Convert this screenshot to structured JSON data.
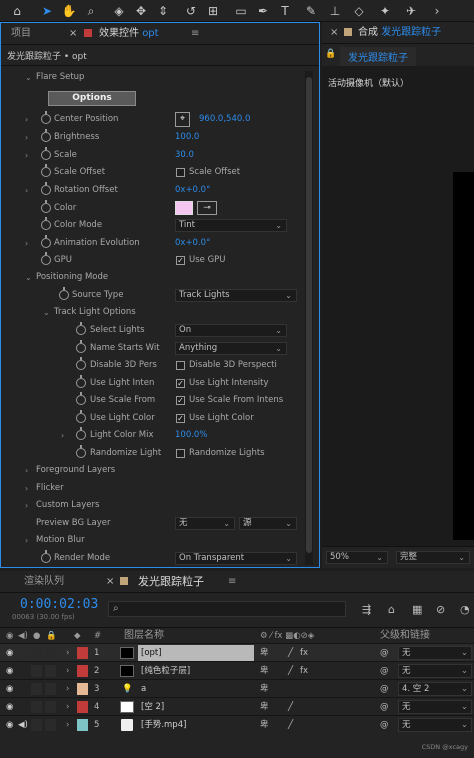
{
  "toolbar": {
    "tools": [
      "home-icon",
      "selection-icon",
      "hand-icon",
      "zoom-icon",
      "orbit-icon",
      "pan-icon",
      "dolly-icon",
      "rotate-icon",
      "shape-icon",
      "rectangle-icon",
      "pen-icon",
      "type-icon",
      "brush-icon",
      "eraser-icon",
      "puppet-icon",
      "pin-icon"
    ]
  },
  "left_tabs": {
    "project": "项目",
    "effects": "效果控件",
    "effects_layer": "opt",
    "menu": "≡"
  },
  "ec": {
    "breadcrumb": "发光跟踪粒子 • opt",
    "flare_setup": "Flare Setup",
    "options_button": "Options",
    "center_position": {
      "label": "Center Position",
      "value": "960.0,540.0"
    },
    "brightness": {
      "label": "Brightness",
      "value": "100.0"
    },
    "scale": {
      "label": "Scale",
      "value": "30.0"
    },
    "scale_offset": {
      "label": "Scale Offset",
      "checkbox": "Scale Offset"
    },
    "rotation_offset": {
      "label": "Rotation Offset",
      "value": "0x+0.0°"
    },
    "color": {
      "label": "Color",
      "swatch": "#f5c6ef"
    },
    "color_mode": {
      "label": "Color Mode",
      "value": "Tint"
    },
    "animation_evolution": {
      "label": "Animation Evolution",
      "value": "0x+0.0°"
    },
    "gpu": {
      "label": "GPU",
      "checkbox": "Use GPU"
    },
    "positioning_mode": "Positioning Mode",
    "source_type": {
      "label": "Source Type",
      "value": "Track Lights"
    },
    "track_light_options": "Track Light Options",
    "select_lights": {
      "label": "Select Lights",
      "value": "On"
    },
    "name_starts": {
      "label": "Name Starts Wit",
      "value": "Anything"
    },
    "disable_3d": {
      "label": "Disable 3D Pers",
      "checkbox": "Disable 3D Perspecti"
    },
    "use_light_int": {
      "label": "Use Light Inten",
      "checkbox": "Use Light Intensity"
    },
    "use_scale_from": {
      "label": "Use Scale From",
      "checkbox": "Use Scale From Intens"
    },
    "use_light_color": {
      "label": "Use Light Color",
      "checkbox": "Use Light Color"
    },
    "light_color_mix": {
      "label": "Light Color Mix",
      "value": "100.0%"
    },
    "randomize_light": {
      "label": "Randomize Light",
      "checkbox": "Randomize Lights"
    },
    "foreground_layers": "Foreground Layers",
    "flicker": "Flicker",
    "custom_layers": "Custom Layers",
    "preview_bg": {
      "label": "Preview BG Layer",
      "value1": "无",
      "value2": "源"
    },
    "motion_blur": "Motion Blur",
    "render_mode": {
      "label": "Render Mode",
      "value": "On Transparent"
    }
  },
  "comp": {
    "tab_label": "合成",
    "tab_name": "发光跟踪粒子",
    "menu": "≡",
    "sub_tab": "发光跟踪粒子",
    "camera": "活动摄像机（默认）",
    "zoom": "50%",
    "resolution": "完整"
  },
  "timeline": {
    "render_queue": "渲染队列",
    "comp_tab": "发光跟踪粒子",
    "menu": "≡",
    "timecode": "0:00:02:03",
    "frame_info": "00063 (30.00 fps)",
    "search_placeholder": "",
    "col_num": "#",
    "col_name": "图层名称",
    "col_parent": "父级和链接",
    "layers": [
      {
        "num": "1",
        "name": "[opt]",
        "label_color": "#c23b3b",
        "thumb": "#000000",
        "parent": "无",
        "selected": true
      },
      {
        "num": "2",
        "name": "[纯色粒子层]",
        "label_color": "#c23b3b",
        "thumb": "#000000",
        "parent": "无",
        "selected": false
      },
      {
        "num": "3",
        "name": "a",
        "label_color": "#e5b896",
        "thumb": "light",
        "parent": "4. 空 2",
        "selected": false
      },
      {
        "num": "4",
        "name": "[空 2]",
        "label_color": "#c23b3b",
        "thumb": "#ffffff",
        "parent": "无",
        "selected": false
      },
      {
        "num": "5",
        "name": "[手势.mp4]",
        "label_color": "#7fc4c4",
        "thumb": "file",
        "parent": "无",
        "selected": false
      }
    ]
  },
  "watermark": "CSDN @xcagy"
}
